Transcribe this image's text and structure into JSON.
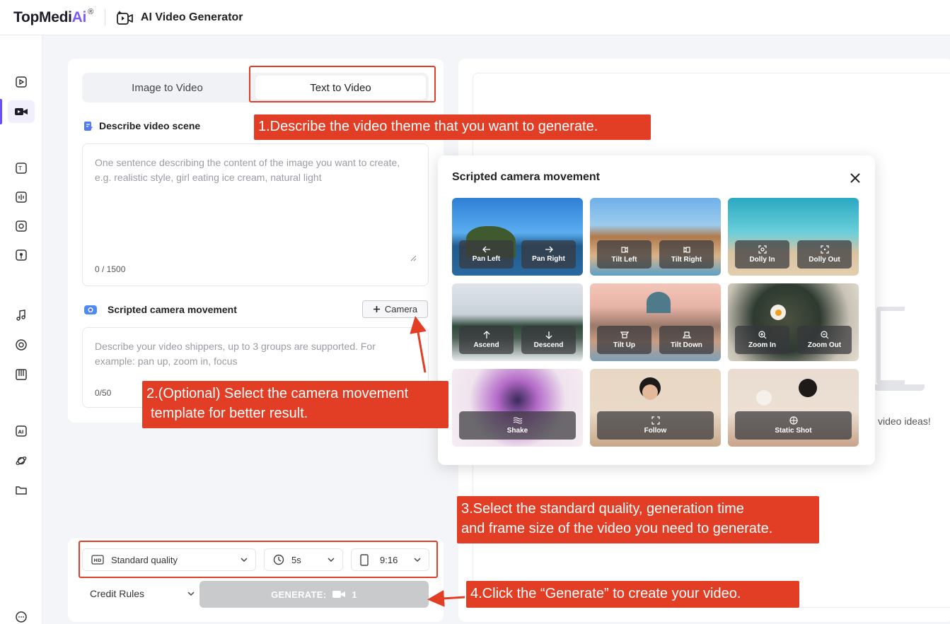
{
  "topbar": {
    "logo_text": "TopMedi",
    "logo_ai": "Ai",
    "logo_reg": "®",
    "app_name": "AI Video Generator"
  },
  "sidebar": {
    "items": [
      {
        "name": "image-video-icon"
      },
      {
        "name": "video-camera-icon"
      },
      {
        "name": "text-speech-icon"
      },
      {
        "name": "voice-changer-icon"
      },
      {
        "name": "audio-icon"
      },
      {
        "name": "podcast-icon"
      },
      {
        "name": "music-note-icon"
      },
      {
        "name": "vocal-remover-icon"
      },
      {
        "name": "piano-icon"
      },
      {
        "name": "ai-box-icon"
      },
      {
        "name": "planet-icon"
      },
      {
        "name": "folder-icon"
      },
      {
        "name": "chat-icon"
      }
    ]
  },
  "tabs": {
    "image_to_video": "Image to Video",
    "text_to_video": "Text to Video"
  },
  "scene": {
    "title": "Describe video scene",
    "placeholder": "One sentence describing the content of the image you want to create, e.g. realistic style, girl eating ice cream, natural light",
    "count": "0 / 1500"
  },
  "camera": {
    "title": "Scripted camera movement",
    "button_label": "Camera",
    "placeholder": "Describe your video shippers, up to 3 groups are supported. For example: pan up, zoom in, focus",
    "count": "0/50"
  },
  "controls": {
    "quality": "Standard quality",
    "duration": "5s",
    "ratio": "9:16",
    "credit_rules": "Credit Rules",
    "generate_label": "GENERATE:",
    "generate_cost": "1"
  },
  "right": {
    "ideas_text": "video ideas!"
  },
  "popup": {
    "title": "Scripted camera movement",
    "tiles": [
      {
        "buttons": [
          "Pan Left",
          "Pan Right"
        ]
      },
      {
        "buttons": [
          "Tilt Left",
          "Tilt Right"
        ]
      },
      {
        "buttons": [
          "Dolly In",
          "Dolly Out"
        ]
      },
      {
        "buttons": [
          "Ascend",
          "Descend"
        ]
      },
      {
        "buttons": [
          "Tilt Up",
          "Tilt Down"
        ]
      },
      {
        "buttons": [
          "Zoom In",
          "Zoom Out"
        ]
      },
      {
        "buttons": [
          "Shake"
        ]
      },
      {
        "buttons": [
          "Follow"
        ]
      },
      {
        "buttons": [
          "Static Shot"
        ]
      }
    ]
  },
  "annotations": {
    "step1": "1.Describe the video theme that you want to generate.",
    "step2_line1": "2.(Optional) Select the camera movement",
    "step2_line2": "template for better result.",
    "step3_line1": "3.Select the standard quality, generation time",
    "step3_line2": "and frame size of the video you need to generate.",
    "step4": "4.Click the “Generate” to create your video."
  },
  "colors": {
    "annotation_red": "#e23e25",
    "accent": "#6a4df4"
  }
}
